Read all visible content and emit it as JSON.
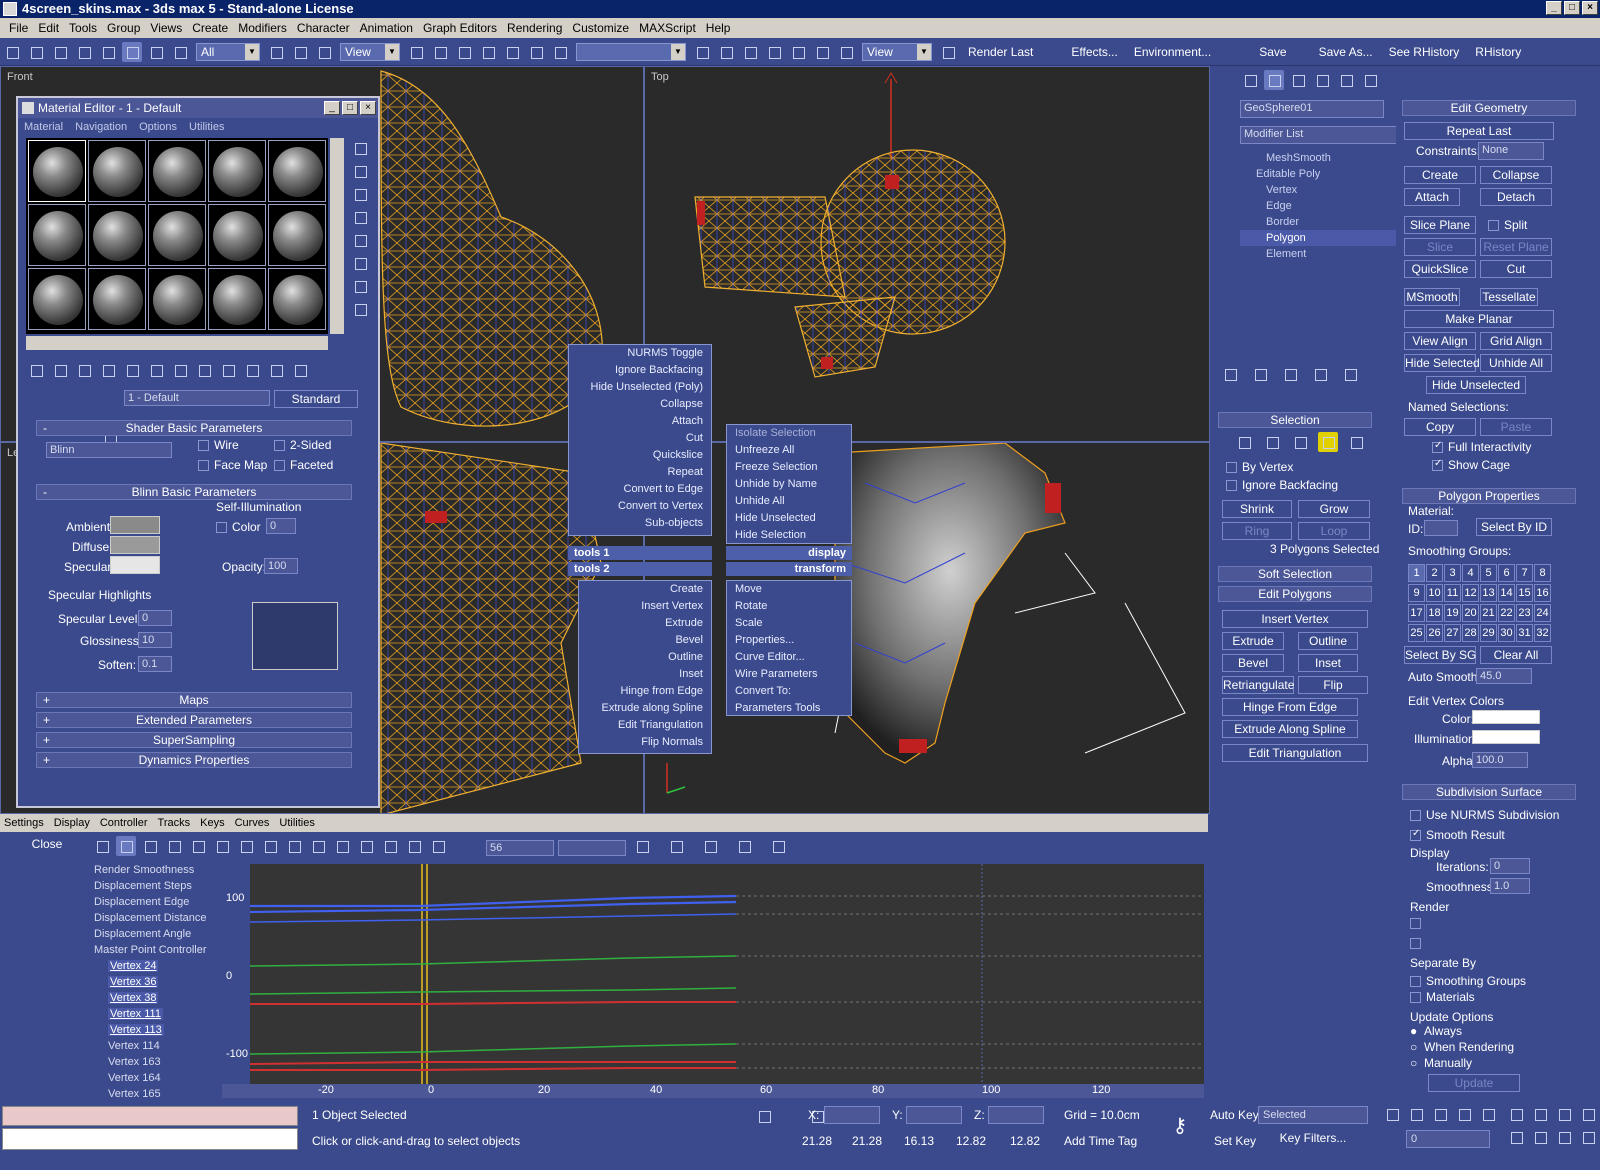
{
  "window": {
    "title": "4screen_skins.max - 3ds max 5 - Stand-alone License"
  },
  "menubar": [
    "File",
    "Edit",
    "Tools",
    "Group",
    "Views",
    "Create",
    "Modifiers",
    "Character",
    "Animation",
    "Graph Editors",
    "Rendering",
    "Customize",
    "MAXScript",
    "Help"
  ],
  "toolbar": {
    "selection_filter": "All",
    "ref_coord": "View",
    "named_sel": "",
    "render_view": "View",
    "render_last": "Render Last",
    "effects": "Effects...",
    "environment": "Environment...",
    "save": "Save",
    "save_as": "Save As...",
    "see_rhistory": "See RHistory",
    "rhistory": "RHistory"
  },
  "viewports": {
    "front": "Front",
    "top": "Top",
    "left": "Le"
  },
  "material_editor": {
    "title": "Material Editor - 1 - Default",
    "menu": [
      "Material",
      "Navigation",
      "Options",
      "Utilities"
    ],
    "material_name": "1 - Default",
    "material_type": "Standard",
    "shader_rollout": "Shader Basic Parameters",
    "shader": "Blinn",
    "wire": "Wire",
    "two_sided": "2-Sided",
    "face_map": "Face Map",
    "faceted": "Faceted",
    "blinn_rollout": "Blinn Basic Parameters",
    "self_illum": "Self-Illumination",
    "ambient": "Ambient:",
    "diffuse": "Diffuse:",
    "specular": "Specular:",
    "color": "Color",
    "color_val": "0",
    "opacity": "Opacity:",
    "opacity_val": "100",
    "spec_highlights": "Specular Highlights",
    "spec_level": "Specular Level:",
    "spec_level_val": "0",
    "glossiness": "Glossiness:",
    "glossiness_val": "10",
    "soften": "Soften:",
    "soften_val": "0.1",
    "rollouts": [
      "Maps",
      "Extended Parameters",
      "SuperSampling",
      "Dynamics Properties"
    ],
    "colors": {
      "ambient": "#8a8a8a",
      "diffuse": "#9a9a9a",
      "specular": "#e6e6e6",
      "highlight_preview": "#2e3a6c"
    }
  },
  "quad_menu": {
    "tools1_left": [
      "NURMS Toggle",
      "Ignore Backfacing",
      "Hide Unselected (Poly)",
      "Collapse",
      "Attach",
      "Cut",
      "Quickslice",
      "Repeat",
      "Convert to Edge",
      "Convert to Vertex",
      "Sub-objects"
    ],
    "tools1_hdr": "tools 1",
    "tools2_hdr": "tools 2",
    "display_hdr": "display",
    "transform_hdr": "transform",
    "display_items": [
      "Isolate Selection",
      "Unfreeze All",
      "Freeze Selection",
      "Unhide by Name",
      "Unhide All",
      "Hide Unselected",
      "Hide Selection"
    ],
    "tools2_left": [
      "Create",
      "Insert Vertex",
      "Extrude",
      "Bevel",
      "Outline",
      "Inset",
      "Hinge from Edge",
      "Extrude along Spline",
      "Edit Triangulation",
      "Flip Normals"
    ],
    "transform_items": [
      "Move",
      "Rotate",
      "Scale",
      "Properties...",
      "Curve Editor...",
      "Wire Parameters",
      "Convert To:",
      "Parameters Tools"
    ]
  },
  "command_panel": {
    "object_name": "GeoSphere01",
    "modifier_list": "Modifier List",
    "stack": [
      "MeshSmooth",
      "Editable Poly",
      "Vertex",
      "Edge",
      "Border",
      "Polygon",
      "Element"
    ],
    "selection_hdr": "Selection",
    "by_vertex": "By Vertex",
    "ignore_backfacing": "Ignore Backfacing",
    "shrink": "Shrink",
    "grow": "Grow",
    "ring": "Ring",
    "loop": "Loop",
    "sel_status": "3 Polygons Selected",
    "soft_selection": "Soft Selection",
    "edit_polygons": "Edit Polygons",
    "insert_vertex": "Insert Vertex",
    "extrude": "Extrude",
    "outline": "Outline",
    "bevel": "Bevel",
    "inset": "Inset",
    "retriangulate": "Retriangulate",
    "flip": "Flip",
    "hinge_from_edge": "Hinge From Edge",
    "extrude_along_spline": "Extrude Along Spline",
    "edit_triangulation": "Edit Triangulation"
  },
  "right_panel": {
    "edit_geometry": "Edit Geometry",
    "repeat_last": "Repeat Last",
    "constraints": "Constraints:",
    "constraints_val": "None",
    "create": "Create",
    "collapse": "Collapse",
    "attach": "Attach",
    "detach": "Detach",
    "slice_plane": "Slice Plane",
    "split": "Split",
    "slice": "Slice",
    "reset_plane": "Reset Plane",
    "quickslice": "QuickSlice",
    "cut": "Cut",
    "msmooth": "MSmooth",
    "tessellate": "Tessellate",
    "make_planar": "Make Planar",
    "view_align": "View Align",
    "grid_align": "Grid Align",
    "hide_selected": "Hide Selected",
    "unhide_all": "Unhide All",
    "hide_unselected": "Hide Unselected",
    "named_selections": "Named Selections:",
    "copy": "Copy",
    "paste": "Paste",
    "full_interactivity": "Full Interactivity",
    "show_cage": "Show Cage",
    "polygon_properties": "Polygon Properties",
    "material": "Material:",
    "id": "ID:",
    "select_by_id": "Select By ID",
    "smoothing_groups": "Smoothing Groups:",
    "sg": [
      "1",
      "2",
      "3",
      "4",
      "5",
      "6",
      "7",
      "8",
      "9",
      "10",
      "11",
      "12",
      "13",
      "14",
      "15",
      "16",
      "17",
      "18",
      "19",
      "20",
      "21",
      "22",
      "23",
      "24",
      "25",
      "26",
      "27",
      "28",
      "29",
      "30",
      "31",
      "32"
    ],
    "select_by_sg": "Select By SG",
    "clear_all": "Clear All",
    "auto_smooth": "Auto Smooth",
    "auto_smooth_val": "45.0",
    "edit_vertex_colors": "Edit Vertex Colors",
    "color": "Color:",
    "illumination": "Illumination:",
    "alpha": "Alpha:",
    "alpha_val": "100.0",
    "subdivision_surface": "Subdivision Surface",
    "use_nurms": "Use NURMS Subdivision",
    "smooth_result": "Smooth Result",
    "display": "Display",
    "iterations": "Iterations:",
    "iterations_val": "0",
    "smoothness": "Smoothness:",
    "smoothness_val": "1.0",
    "render": "Render",
    "separate_by": "Separate By",
    "sep_smoothing_groups": "Smoothing Groups",
    "sep_materials": "Materials",
    "update_options": "Update Options",
    "always": "Always",
    "when_rendering": "When Rendering",
    "manually": "Manually",
    "update": "Update"
  },
  "trackview": {
    "tabs": [
      "Settings",
      "Display",
      "Controller",
      "Tracks",
      "Keys",
      "Curves",
      "Utilities"
    ],
    "close": "Close",
    "frame_field": "56",
    "tree": [
      "Render Smoothness",
      "Displacement Steps",
      "Displacement Edge",
      "Displacement Distance",
      "Displacement Angle",
      "Master Point Controller",
      "Vertex 24",
      "Vertex 36",
      "Vertex 38",
      "Vertex 111",
      "Vertex 113",
      "Vertex 114",
      "Vertex 163",
      "Vertex 164",
      "Vertex 165"
    ],
    "y_labels": [
      "100",
      "0",
      "-100"
    ],
    "x_labels": [
      "-20",
      "0",
      "20",
      "40",
      "60",
      "80",
      "100",
      "120"
    ]
  },
  "status": {
    "selected": "1 Object Selected",
    "prompt": "Click or click-and-drag to select objects",
    "x_label": "X:",
    "y_label": "Y:",
    "z_label": "Z:",
    "grid": "Grid = 10.0cm",
    "add_time_tag": "Add Time Tag",
    "readouts": [
      "21.28",
      "21.28",
      "16.13",
      "12.82",
      "12.82"
    ],
    "auto_key": "Auto Key",
    "set_key": "Set Key",
    "selected_dd": "Selected",
    "key_filters": "Key Filters...",
    "frame": "0"
  }
}
